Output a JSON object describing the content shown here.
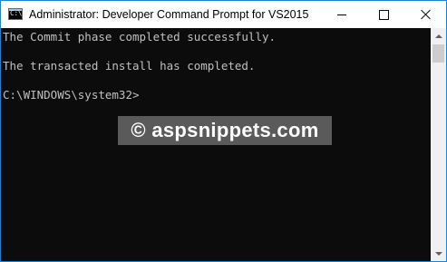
{
  "window": {
    "title": "Administrator: Developer Command Prompt for VS2015",
    "icon": "cmd-icon",
    "icon_glyph": "C:\\."
  },
  "console": {
    "lines": [
      "The Commit phase completed successfully.",
      "The transacted install has completed.",
      "C:\\WINDOWS\\system32>"
    ]
  },
  "watermark": {
    "text": "© aspsnippets.com"
  },
  "colors": {
    "console_bg": "#0c0c0c",
    "console_text": "#c0c0c0",
    "window_border": "#1883d7",
    "watermark_bg": "#5a5a5a"
  }
}
